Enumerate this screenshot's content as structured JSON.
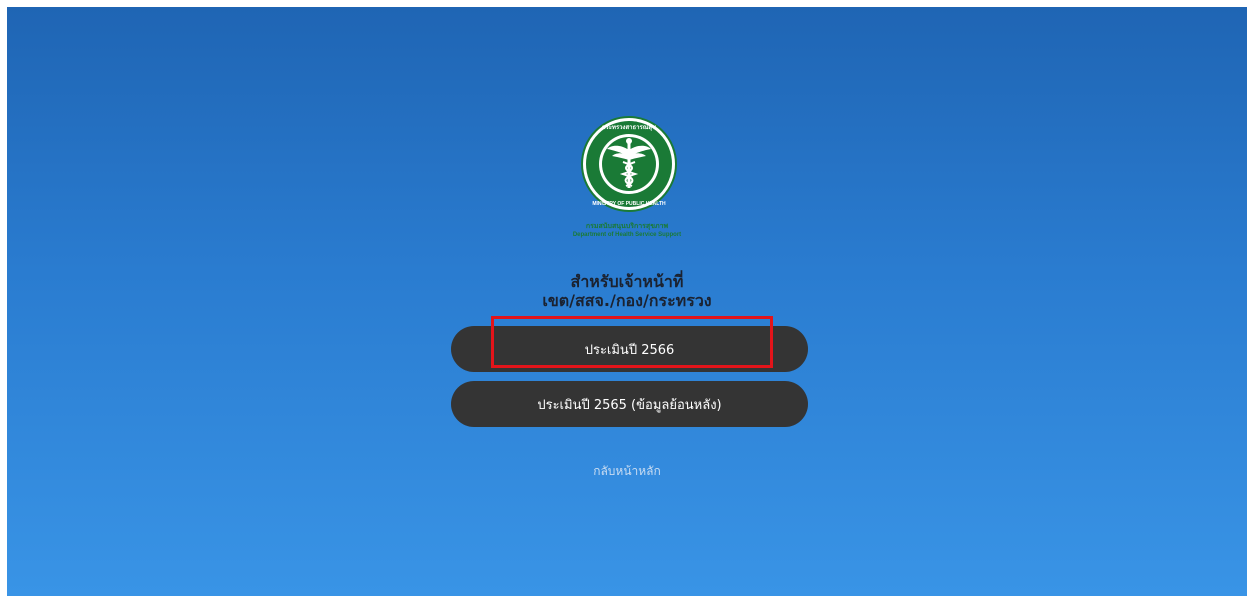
{
  "logo": {
    "ring_text": "กระทรวงสาธารณสุข",
    "ring_text_en": "MINISTRY OF PUBLIC HEALTH",
    "dept_th": "กรมสนับสนุนบริการสุขภาพ",
    "dept_en": "Department of Health Service Support",
    "brand_color": "#1a7a36"
  },
  "heading": {
    "line1": "สำหรับเจ้าหน้าที่",
    "line2": "เขต/สสจ./กอง/กระทรวง"
  },
  "buttons": {
    "assess_2566": "ประเมินปี 2566",
    "assess_2565": "ประเมินปี 2565 (ข้อมูลย้อนหลัง)"
  },
  "back_link": "กลับหน้าหลัก",
  "colors": {
    "bg_top": "#1f65b4",
    "bg_bottom": "#3994e6",
    "button": "#343434",
    "highlight": "#e3141a"
  }
}
